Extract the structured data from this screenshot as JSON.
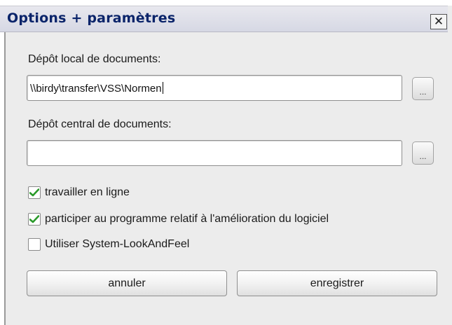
{
  "window": {
    "title": "Options + paramètres",
    "close_glyph": "✕"
  },
  "local_repo": {
    "label": "Dépôt local de documents:",
    "value": "\\\\birdy\\transfer\\VSS\\Normen",
    "browse_label": "..."
  },
  "central_repo": {
    "label": "Dépôt central de documents:",
    "value": "",
    "browse_label": "..."
  },
  "options": [
    {
      "label": "travailler en ligne",
      "checked": true
    },
    {
      "label": "participer au programme relatif à l'amélioration du logiciel",
      "checked": true
    },
    {
      "label": "Utiliser System-LookAndFeel",
      "checked": false
    }
  ],
  "buttons": {
    "cancel_label": "annuler",
    "save_label": "enregistrer"
  },
  "colors": {
    "title_text": "#0a246a",
    "check_mark": "#2a9a2a",
    "window_bg": "#ececec"
  }
}
